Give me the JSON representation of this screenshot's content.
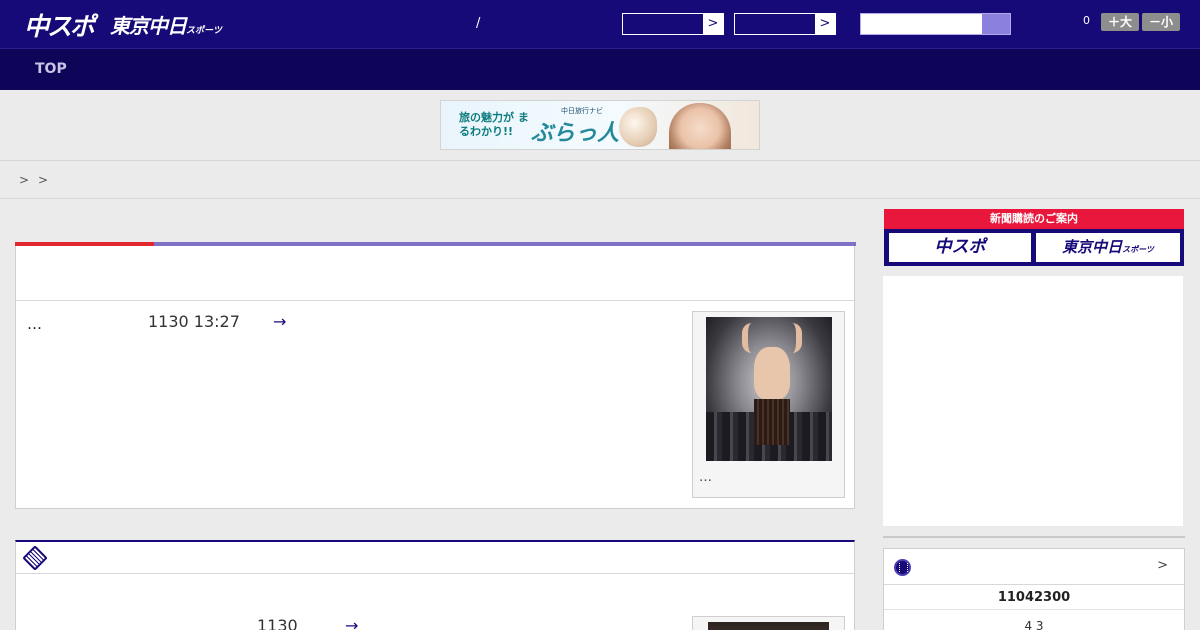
{
  "header": {
    "logo_primary": "中スポ",
    "logo_secondary": "東京中日",
    "logo_secondary_sub": "スポーツ",
    "slash": "/",
    "select_arrow_1": ">",
    "select_arrow_2": ">",
    "search": {
      "placeholder": ""
    },
    "count": "0",
    "font_larger": "＋大",
    "font_smaller": "－小",
    "colors": {
      "header_bg": "#160a78",
      "nav_bg": "#0f0558",
      "accent_red": "#e2272e",
      "accent_purple": "#7d72c6"
    }
  },
  "nav": {
    "top": "TOP"
  },
  "banner": {
    "text_left": "旅の魅力が まるわかり!!",
    "text_sub": "中日旅行ナビ",
    "text_title": "ぶらっ人"
  },
  "breadcrumb": {
    "sep1": ">",
    "sep2": ">"
  },
  "article1": {
    "ellipsis": "…",
    "date": "1130 13:27",
    "arrow": "→",
    "caption": "…"
  },
  "article2": {
    "icon": "newspaper-icon",
    "date": "1130",
    "arrow": "→"
  },
  "sidebar": {
    "promo_title": "新聞購読のご案内",
    "promo_btn_1": "中スポ",
    "promo_btn_2": "東京中日",
    "promo_btn_2_sub": "スポーツ",
    "score_icon": "baseball-icon",
    "score_more": ">",
    "score_row": "11042300",
    "score_row2": "4 3"
  }
}
